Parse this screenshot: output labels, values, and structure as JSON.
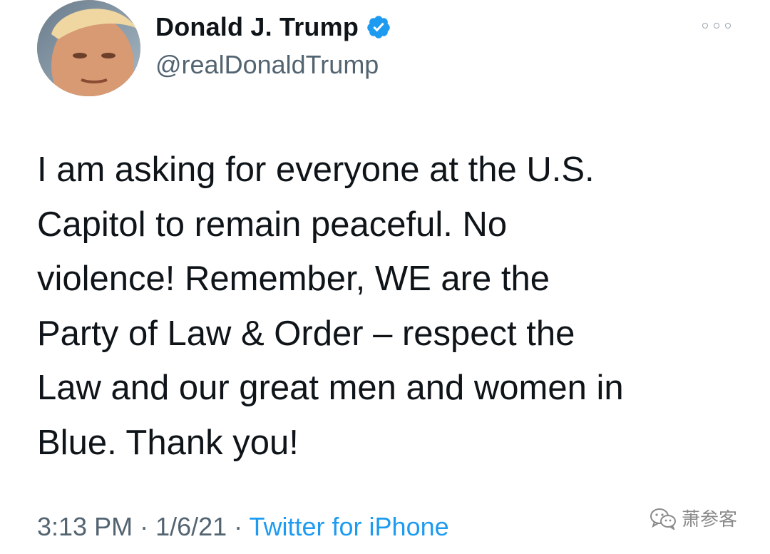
{
  "author": {
    "display_name": "Donald J. Trump",
    "handle": "@realDonaldTrump",
    "verified": true,
    "verified_color": "#1d9bf0"
  },
  "tweet": {
    "lines": [
      "I am asking for everyone at the U.S.",
      "Capitol to remain peaceful. No",
      "violence! Remember, WE are the",
      "Party of Law & Order – respect the",
      "Law and our great men and women in",
      "Blue. Thank you!"
    ]
  },
  "meta": {
    "time": "3:13 PM",
    "separator": " · ",
    "date": "1/6/21",
    "source": "Twitter for iPhone"
  },
  "watermark": {
    "text": "萧参客",
    "icon": "wechat-icon"
  },
  "icons": {
    "more": "more-icon",
    "verified": "verified-badge-icon"
  }
}
